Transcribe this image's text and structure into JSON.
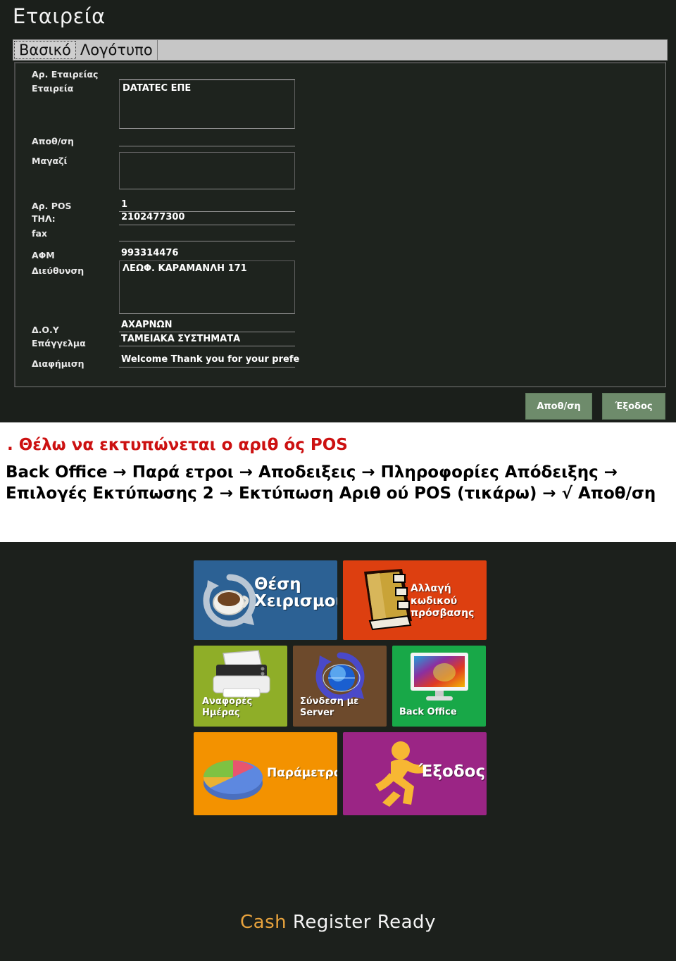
{
  "company_window": {
    "title": "Εταιρεία",
    "tabs": [
      {
        "label": "Βασικό",
        "active": true
      },
      {
        "label": "Λογότυπο",
        "active": false
      }
    ],
    "fields": [
      {
        "label": "Αρ. Εταιρείας",
        "value": ""
      },
      {
        "label": "Εταιρεία",
        "value": "DATATEC ΕΠΕ"
      },
      {
        "label": "Αποθ/ση",
        "value": ""
      },
      {
        "label": "Μαγαζί",
        "value": ""
      },
      {
        "label": "Αρ. POS",
        "value": "1"
      },
      {
        "label": "ΤΗΛ:",
        "value": "2102477300"
      },
      {
        "label": "fax",
        "value": ""
      },
      {
        "label": "ΑΦΜ",
        "value": "993314476"
      },
      {
        "label": "Διεύθυνση",
        "value": "ΛΕΩΦ. ΚΑΡΑΜΑΝΛΗ 171"
      },
      {
        "label": "Δ.Ο.Υ",
        "value": "ΑΧΑΡΝΩΝ"
      },
      {
        "label": "Επάγγελμα",
        "value": "ΤΑΜΕΙΑΚΑ ΣΥΣΤΗΜΑΤΑ"
      },
      {
        "label": "Διαφήμιση",
        "value": "Welcome Thank you for your  prefe"
      }
    ],
    "buttons": {
      "save": "Αποθ/ση",
      "exit": "Έξοδος",
      "color": "#6e8b6b"
    }
  },
  "instructions": {
    "heading": ". Θέλω να εκτυπώνεται ο αριθ  ός POS",
    "heading_color": "#cc1111",
    "body": "Back Office → Παρά  ετροι → Αποδειξεις → Πληροφορίες Απόδειξης → Επιλογές Εκτύπωσης 2 → Εκτύπωση Αριθ  ού POS (τικάρω) → √ Αποθ/ση"
  },
  "pos_screen": {
    "tiles": [
      {
        "label": "Θέση\nΧειρισμού",
        "color": "#2c6194",
        "icon": "coffee-refresh-icon"
      },
      {
        "label": "Αλλαγή κωδικού\nπρόσβασης",
        "color": "#dd3f10",
        "icon": "notebook-icon"
      },
      {
        "label": "Αναφορές\nΗμέρας",
        "color": "#8fae28",
        "icon": "printer-icon"
      },
      {
        "label": "Σύνδεση με\nServer",
        "color": "#6d4a2c",
        "icon": "globe-sync-icon"
      },
      {
        "label": "Back Office",
        "color": "#18a848",
        "icon": "monitor-icon"
      },
      {
        "label": "Παράμετροι",
        "color": "#f39200",
        "icon": "pie-chart-icon"
      },
      {
        "label": "Έξοδος",
        "color": "#9b2585",
        "icon": "running-man-icon"
      }
    ],
    "status": {
      "prefix": "Cash",
      "rest": " Register Ready",
      "accent_color": "#e8a33d"
    }
  }
}
